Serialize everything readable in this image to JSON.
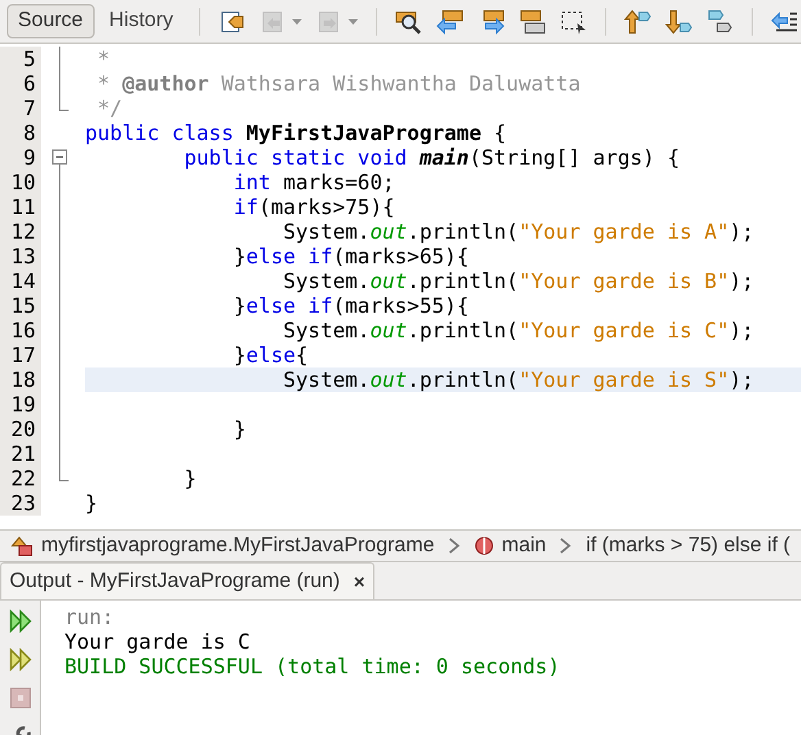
{
  "tabs": [
    {
      "label": "Source",
      "selected": true
    },
    {
      "label": "History",
      "selected": false
    }
  ],
  "toolbar_groups": [
    [
      {
        "kind": "toggle-bookmark",
        "disabled": false,
        "dropdown": false
      },
      {
        "kind": "previous-bookmark",
        "disabled": true,
        "dropdown": true
      },
      {
        "kind": "next-bookmark",
        "disabled": true,
        "dropdown": true
      }
    ],
    [
      {
        "kind": "find",
        "disabled": false,
        "dropdown": false
      },
      {
        "kind": "find-previous",
        "disabled": false,
        "dropdown": false
      },
      {
        "kind": "find-next",
        "disabled": false,
        "dropdown": false
      },
      {
        "kind": "highlight",
        "disabled": false,
        "dropdown": false
      },
      {
        "kind": "select",
        "disabled": false,
        "dropdown": false
      }
    ],
    [
      {
        "kind": "move-up",
        "disabled": false,
        "dropdown": false
      },
      {
        "kind": "move-down",
        "disabled": false,
        "dropdown": false
      },
      {
        "kind": "shapes",
        "disabled": false,
        "dropdown": false
      }
    ],
    [
      {
        "kind": "shift-left",
        "disabled": false,
        "dropdown": false
      }
    ]
  ],
  "code_lines": [
    {
      "number": "5",
      "fold_start": false,
      "fold_guide": true,
      "fold_end": false,
      "current": false,
      "segments": [
        {
          "kind": "comment",
          "text": " *"
        }
      ]
    },
    {
      "number": "6",
      "fold_start": false,
      "fold_guide": true,
      "fold_end": false,
      "current": false,
      "segments": [
        {
          "kind": "comment",
          "text": " * "
        },
        {
          "kind": "annotation",
          "text": "@author"
        },
        {
          "kind": "comment",
          "text": " Wathsara Wishwantha Daluwatta"
        }
      ]
    },
    {
      "number": "7",
      "fold_start": false,
      "fold_guide": false,
      "fold_end": true,
      "current": false,
      "segments": [
        {
          "kind": "comment",
          "text": " */"
        }
      ]
    },
    {
      "number": "8",
      "fold_start": false,
      "fold_guide": false,
      "fold_end": false,
      "current": false,
      "segments": [
        {
          "kind": "keyword",
          "text": "public class "
        },
        {
          "kind": "classname",
          "text": "MyFirstJavaPrograme"
        },
        {
          "kind": "plain",
          "text": " {"
        }
      ]
    },
    {
      "number": "9",
      "fold_start": true,
      "fold_guide": false,
      "fold_end": false,
      "current": false,
      "segments": [
        {
          "kind": "keyword",
          "text": "        public static void "
        },
        {
          "kind": "method",
          "text": "main"
        },
        {
          "kind": "plain",
          "text": "(String[] args) {"
        }
      ]
    },
    {
      "number": "10",
      "fold_start": false,
      "fold_guide": true,
      "fold_end": false,
      "current": false,
      "segments": [
        {
          "kind": "keyword",
          "text": "            int"
        },
        {
          "kind": "plain",
          "text": " marks=60;"
        }
      ]
    },
    {
      "number": "11",
      "fold_start": false,
      "fold_guide": true,
      "fold_end": false,
      "current": false,
      "segments": [
        {
          "kind": "keyword",
          "text": "            if"
        },
        {
          "kind": "plain",
          "text": "(marks>75){"
        }
      ]
    },
    {
      "number": "12",
      "fold_start": false,
      "fold_guide": true,
      "fold_end": false,
      "current": false,
      "segments": [
        {
          "kind": "plain",
          "text": "                System."
        },
        {
          "kind": "field",
          "text": "out"
        },
        {
          "kind": "plain",
          "text": ".println("
        },
        {
          "kind": "string",
          "text": "\"Your garde is A\""
        },
        {
          "kind": "plain",
          "text": ");"
        }
      ]
    },
    {
      "number": "13",
      "fold_start": false,
      "fold_guide": true,
      "fold_end": false,
      "current": false,
      "segments": [
        {
          "kind": "plain",
          "text": "            }"
        },
        {
          "kind": "keyword",
          "text": "else if"
        },
        {
          "kind": "plain",
          "text": "(marks>65){"
        }
      ]
    },
    {
      "number": "14",
      "fold_start": false,
      "fold_guide": true,
      "fold_end": false,
      "current": false,
      "segments": [
        {
          "kind": "plain",
          "text": "                System."
        },
        {
          "kind": "field",
          "text": "out"
        },
        {
          "kind": "plain",
          "text": ".println("
        },
        {
          "kind": "string",
          "text": "\"Your garde is B\""
        },
        {
          "kind": "plain",
          "text": ");"
        }
      ]
    },
    {
      "number": "15",
      "fold_start": false,
      "fold_guide": true,
      "fold_end": false,
      "current": false,
      "segments": [
        {
          "kind": "plain",
          "text": "            }"
        },
        {
          "kind": "keyword",
          "text": "else if"
        },
        {
          "kind": "plain",
          "text": "(marks>55){"
        }
      ]
    },
    {
      "number": "16",
      "fold_start": false,
      "fold_guide": true,
      "fold_end": false,
      "current": false,
      "segments": [
        {
          "kind": "plain",
          "text": "                System."
        },
        {
          "kind": "field",
          "text": "out"
        },
        {
          "kind": "plain",
          "text": ".println("
        },
        {
          "kind": "string",
          "text": "\"Your garde is C\""
        },
        {
          "kind": "plain",
          "text": ");"
        }
      ]
    },
    {
      "number": "17",
      "fold_start": false,
      "fold_guide": true,
      "fold_end": false,
      "current": false,
      "segments": [
        {
          "kind": "plain",
          "text": "            }"
        },
        {
          "kind": "keyword",
          "text": "else"
        },
        {
          "kind": "plain",
          "text": "{"
        }
      ]
    },
    {
      "number": "18",
      "fold_start": false,
      "fold_guide": true,
      "fold_end": false,
      "current": true,
      "segments": [
        {
          "kind": "plain",
          "text": "                System."
        },
        {
          "kind": "field",
          "text": "out"
        },
        {
          "kind": "plain",
          "text": ".println("
        },
        {
          "kind": "string",
          "text": "\"Your garde is S\""
        },
        {
          "kind": "plain",
          "text": ");"
        }
      ]
    },
    {
      "number": "19",
      "fold_start": false,
      "fold_guide": true,
      "fold_end": false,
      "current": false
    },
    {
      "number": "20",
      "fold_start": false,
      "fold_guide": true,
      "fold_end": false,
      "current": false,
      "segments": [
        {
          "kind": "plain",
          "text": "            }"
        }
      ]
    },
    {
      "number": "21",
      "fold_start": false,
      "fold_guide": true,
      "fold_end": false,
      "current": false
    },
    {
      "number": "22",
      "fold_start": false,
      "fold_guide": false,
      "fold_end": true,
      "current": false,
      "segments": [
        {
          "kind": "plain",
          "text": "        }"
        }
      ]
    },
    {
      "number": "23",
      "fold_start": false,
      "fold_guide": false,
      "fold_end": false,
      "current": false,
      "segments": [
        {
          "kind": "plain",
          "text": "}"
        }
      ]
    }
  ],
  "breadcrumb": [
    {
      "kind": "class",
      "text": "myfirstjavaprograme.MyFirstJavaPrograme"
    },
    {
      "kind": "method",
      "text": "main"
    },
    {
      "kind": "statement",
      "text": "if (marks > 75) else if ("
    }
  ],
  "output": {
    "title": "Output - MyFirstJavaPrograme (run)",
    "close": "×",
    "buttons": [
      {
        "kind": "rerun",
        "disabled": false
      },
      {
        "kind": "rerun-alt",
        "disabled": false
      },
      {
        "kind": "stop",
        "disabled": true
      },
      {
        "kind": "settings",
        "disabled": false
      }
    ],
    "lines": [
      {
        "kind": "info",
        "text": "run:"
      },
      {
        "kind": "plain",
        "text": "Your garde is C"
      },
      {
        "kind": "success",
        "text": "BUILD SUCCESSFUL (total time: 0 seconds)"
      }
    ]
  }
}
